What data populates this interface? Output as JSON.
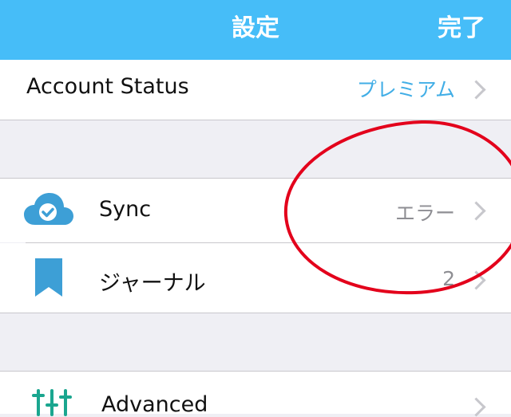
{
  "navbar": {
    "title": "設定",
    "done_label": "完了"
  },
  "account": {
    "label": "Account Status",
    "value": "プレミアム"
  },
  "sync": {
    "label": "Sync",
    "value": "エラー",
    "icon": "cloud-check-icon"
  },
  "journal": {
    "label": "ジャーナル",
    "value": "2",
    "icon": "bookmark-icon"
  },
  "advanced": {
    "label": "Advanced",
    "icon": "sliders-icon"
  },
  "colors": {
    "navbar": "#46bdf8",
    "accent": "#42aee6",
    "value_gray": "#8e8e93",
    "annotation_red": "#e3001b",
    "advanced_icon": "#1aa68f"
  }
}
